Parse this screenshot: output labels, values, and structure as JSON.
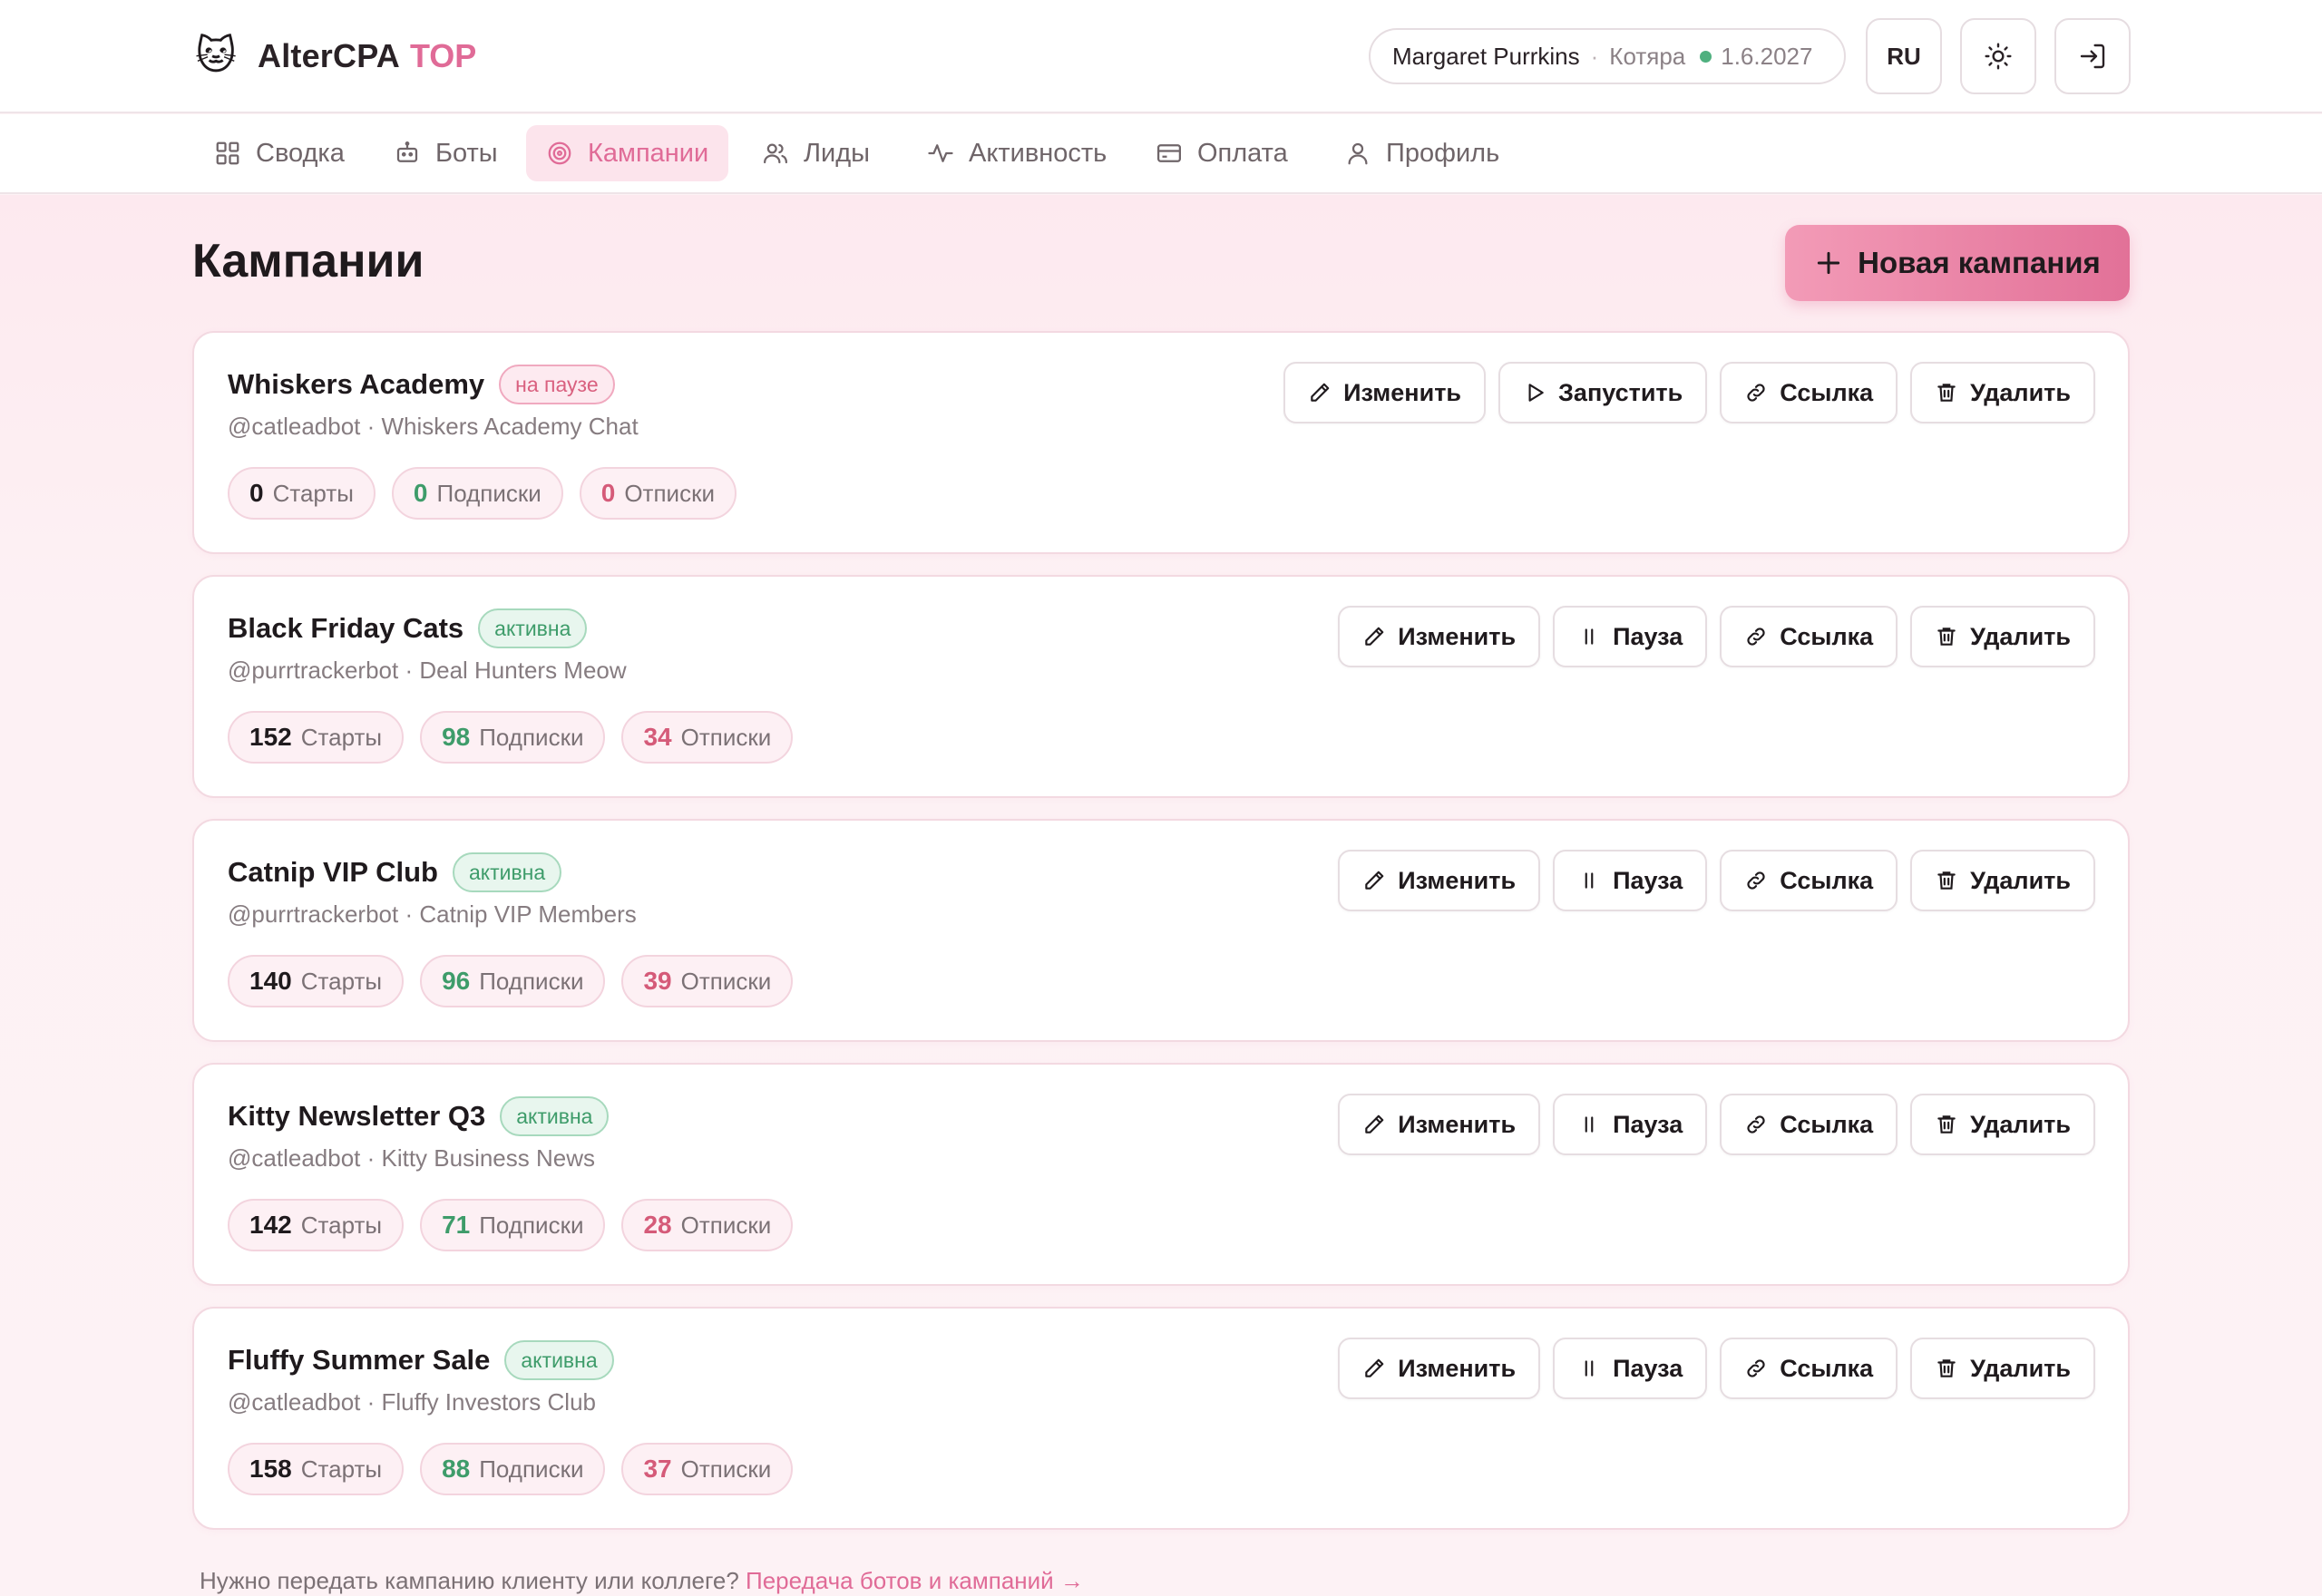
{
  "app": {
    "logo": "🐱",
    "name": "AlterCPA",
    "tier_accent": "TOP"
  },
  "user": {
    "name": "Margaret Purrkins",
    "separator": "·",
    "tier": "Котяра",
    "expires": "1.6.2027"
  },
  "header": {
    "lang": "RU",
    "theme_icon": "sun-icon",
    "logout_icon": "logout-icon"
  },
  "nav": [
    {
      "label": "Сводка",
      "icon": "grid-icon",
      "active": false
    },
    {
      "label": "Боты",
      "icon": "bot-icon",
      "active": false
    },
    {
      "label": "Кампании",
      "icon": "target-icon",
      "active": true
    },
    {
      "label": "Лиды",
      "icon": "users-icon",
      "active": false
    },
    {
      "label": "Активность",
      "icon": "activity-icon",
      "active": false
    },
    {
      "label": "Оплата",
      "icon": "card-icon",
      "active": false
    },
    {
      "label": "Профиль",
      "icon": "user-icon",
      "active": false
    }
  ],
  "page": {
    "title": "Кампании",
    "new_button": "Новая кампания"
  },
  "stat_labels": {
    "starts": "Старты",
    "subs": "Подписки",
    "unsubs": "Отписки"
  },
  "action_labels": {
    "edit": "Изменить",
    "start": "Запустить",
    "pause": "Пауза",
    "link": "Ссылка",
    "delete": "Удалить"
  },
  "campaigns": [
    {
      "name": "Whiskers Academy",
      "status": "на паузе",
      "status_type": "paused",
      "subtitle": "@catleadbot · Whiskers Academy Chat",
      "starts": "0",
      "subs": "0",
      "unsubs": "0"
    },
    {
      "name": "Black Friday Cats",
      "status": "активна",
      "status_type": "active",
      "subtitle": "@purrtrackerbot · Deal Hunters Meow",
      "starts": "152",
      "subs": "98",
      "unsubs": "34"
    },
    {
      "name": "Catnip VIP Club",
      "status": "активна",
      "status_type": "active",
      "subtitle": "@purrtrackerbot · Catnip VIP Members",
      "starts": "140",
      "subs": "96",
      "unsubs": "39"
    },
    {
      "name": "Kitty Newsletter Q3",
      "status": "активна",
      "status_type": "active",
      "subtitle": "@catleadbot · Kitty Business News",
      "starts": "142",
      "subs": "71",
      "unsubs": "28"
    },
    {
      "name": "Fluffy Summer Sale",
      "status": "активна",
      "status_type": "active",
      "subtitle": "@catleadbot · Fluffy Investors Club",
      "starts": "158",
      "subs": "88",
      "unsubs": "37"
    }
  ],
  "footer": {
    "text": "Нужно передать кампанию клиенту или коллеге?",
    "link": "Передача ботов и кампаний →"
  },
  "colors": {
    "accent": "#e06b97",
    "active": "#3e9c6a",
    "paused": "#d9607f"
  }
}
